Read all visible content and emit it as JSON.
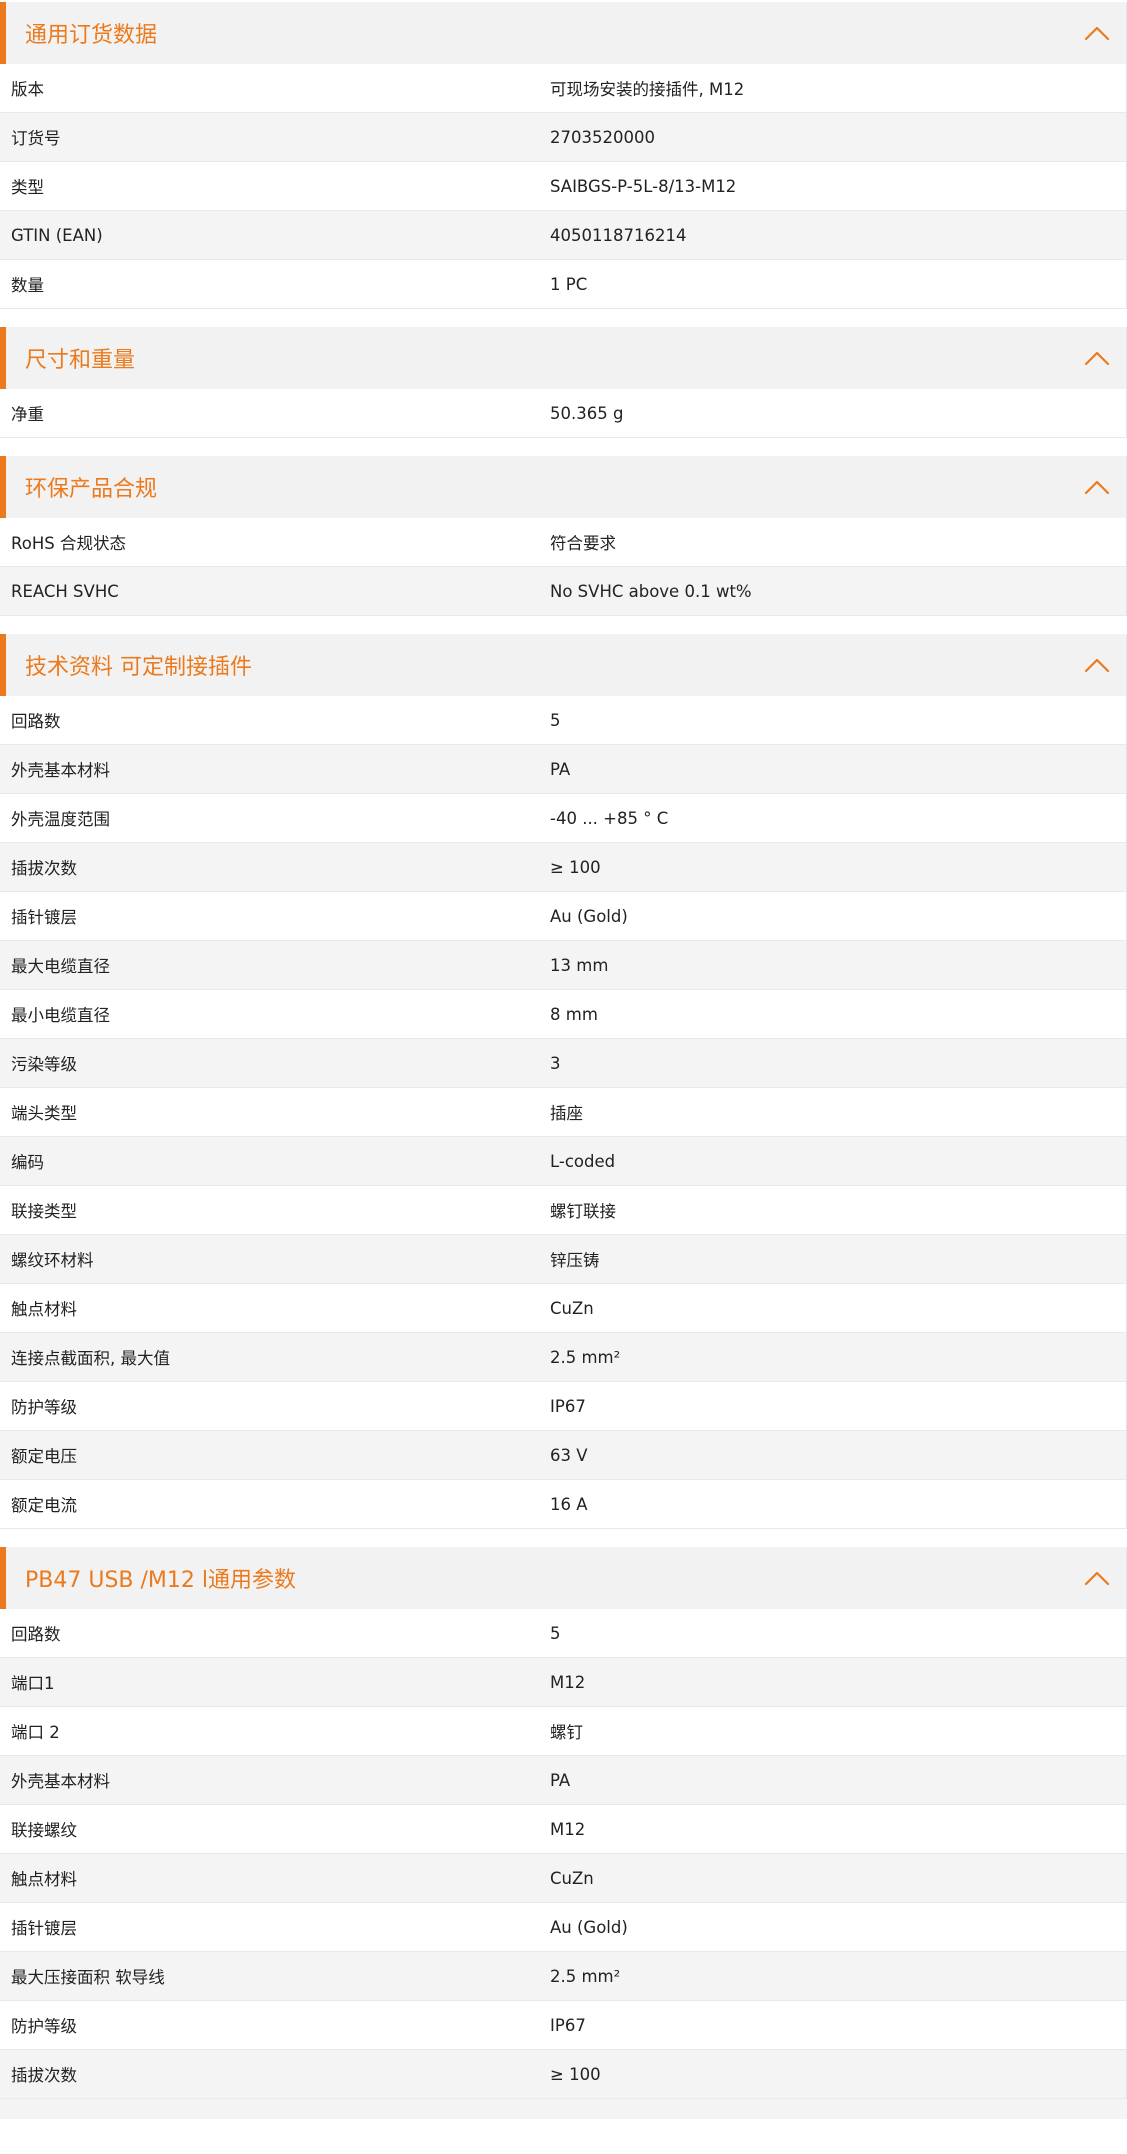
{
  "colors": {
    "accent": "#ec7a1c",
    "header_bg": "#f2f2f2",
    "stripe_bg": "#f4f4f4"
  },
  "sections": [
    {
      "title": "通用订货数据",
      "icon": "chevron-up-icon",
      "rows": [
        {
          "label": "版本",
          "value": "可现场安装的接插件, M12"
        },
        {
          "label": "订货号",
          "value": "2703520000"
        },
        {
          "label": "类型",
          "value": "SAIBGS-P-5L-8/13-M12"
        },
        {
          "label": "GTIN (EAN)",
          "value": "4050118716214"
        },
        {
          "label": "数量",
          "value": "1  PC"
        }
      ]
    },
    {
      "title": "尺寸和重量",
      "icon": "chevron-up-icon",
      "rows": [
        {
          "label": "净重",
          "value": "50.365  g"
        }
      ]
    },
    {
      "title": "环保产品合规",
      "icon": "chevron-up-icon",
      "rows": [
        {
          "label": "RoHS 合规状态",
          "value": "符合要求"
        },
        {
          "label": "REACH SVHC",
          "value": "No SVHC above 0.1 wt%"
        }
      ]
    },
    {
      "title": "技术资料 可定制接插件",
      "icon": "chevron-up-icon",
      "rows": [
        {
          "label": "回路数",
          "value": "5"
        },
        {
          "label": "外壳基本材料",
          "value": "PA"
        },
        {
          "label": "外壳温度范围",
          "value": "-40 ... +85 ° C"
        },
        {
          "label": "插拔次数",
          "value": "≥ 100"
        },
        {
          "label": "插针镀层",
          "value": "Au (Gold)"
        },
        {
          "label": "最大电缆直径",
          "value": "13  mm"
        },
        {
          "label": "最小电缆直径",
          "value": "8  mm"
        },
        {
          "label": "污染等级",
          "value": "3"
        },
        {
          "label": "端头类型",
          "value": "插座"
        },
        {
          "label": "编码",
          "value": "L-coded"
        },
        {
          "label": "联接类型",
          "value": "螺钉联接"
        },
        {
          "label": "螺纹环材料",
          "value": "锌压铸"
        },
        {
          "label": "触点材料",
          "value": "CuZn"
        },
        {
          "label": "连接点截面积, 最大值",
          "value": "2.5  mm²"
        },
        {
          "label": "防护等级",
          "value": "IP67"
        },
        {
          "label": "额定电压",
          "value": "63  V"
        },
        {
          "label": "额定电流",
          "value": "16  A"
        }
      ]
    },
    {
      "title": "PB47 USB /M12 l通用参数",
      "icon": "chevron-up-icon",
      "rows": [
        {
          "label": "回路数",
          "value": "5"
        },
        {
          "label": "端口1",
          "value": "M12"
        },
        {
          "label": "端口 2",
          "value": "螺钉"
        },
        {
          "label": "外壳基本材料",
          "value": "PA"
        },
        {
          "label": "联接螺纹",
          "value": "M12"
        },
        {
          "label": "触点材料",
          "value": "CuZn"
        },
        {
          "label": "插针镀层",
          "value": "Au (Gold)"
        },
        {
          "label": "最大压接面积 软导线",
          "value": "2.5  mm²"
        },
        {
          "label": "防护等级",
          "value": "IP67"
        },
        {
          "label": "插拔次数",
          "value": "≥ 100"
        }
      ]
    }
  ]
}
